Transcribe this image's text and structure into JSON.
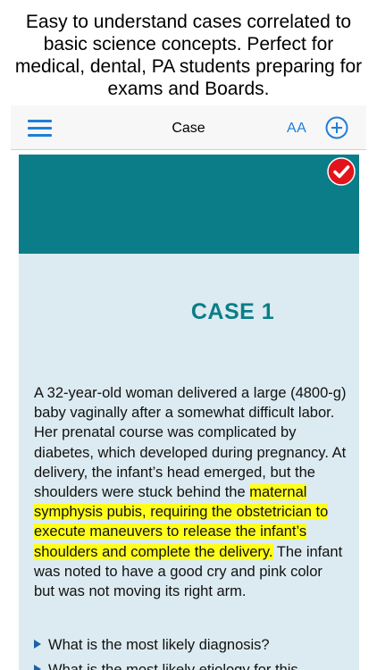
{
  "promo": {
    "text": "Easy to understand cases correlated to basic science concepts. Perfect for medical, dental, PA students preparing for exams and Boards."
  },
  "navbar": {
    "title": "Case",
    "font_size_label": "AA",
    "menu_icon": "hamburger-menu-icon",
    "add_icon": "plus-circle-icon"
  },
  "card": {
    "badge_icon": "checkmark-icon",
    "case_title": "CASE 1",
    "paragraph_before": "A 32-year-old woman delivered a large (4800-g) baby vaginally after a somewhat difficult labor. Her prenatal course was complicated by diabetes, which developed during pregnancy. At delivery, the infant’s head emerged, but the shoulders were stuck behind the ",
    "highlighted": "maternal symphysis pubis, requiring the obstetrician to execute maneuvers to release the infant’s shoulders and complete the delivery.",
    "paragraph_after": " The infant was noted to have a good cry and pink color but was not moving its right arm.",
    "questions": [
      "What is the most likely diagnosis?",
      "What is the most likely etiology for this"
    ]
  },
  "colors": {
    "accent": "#1f7ed8",
    "header_teal": "#0b7d88",
    "card_bg": "#dcebf1",
    "highlight": "#ffff1a",
    "badge_red": "#e3131b"
  }
}
